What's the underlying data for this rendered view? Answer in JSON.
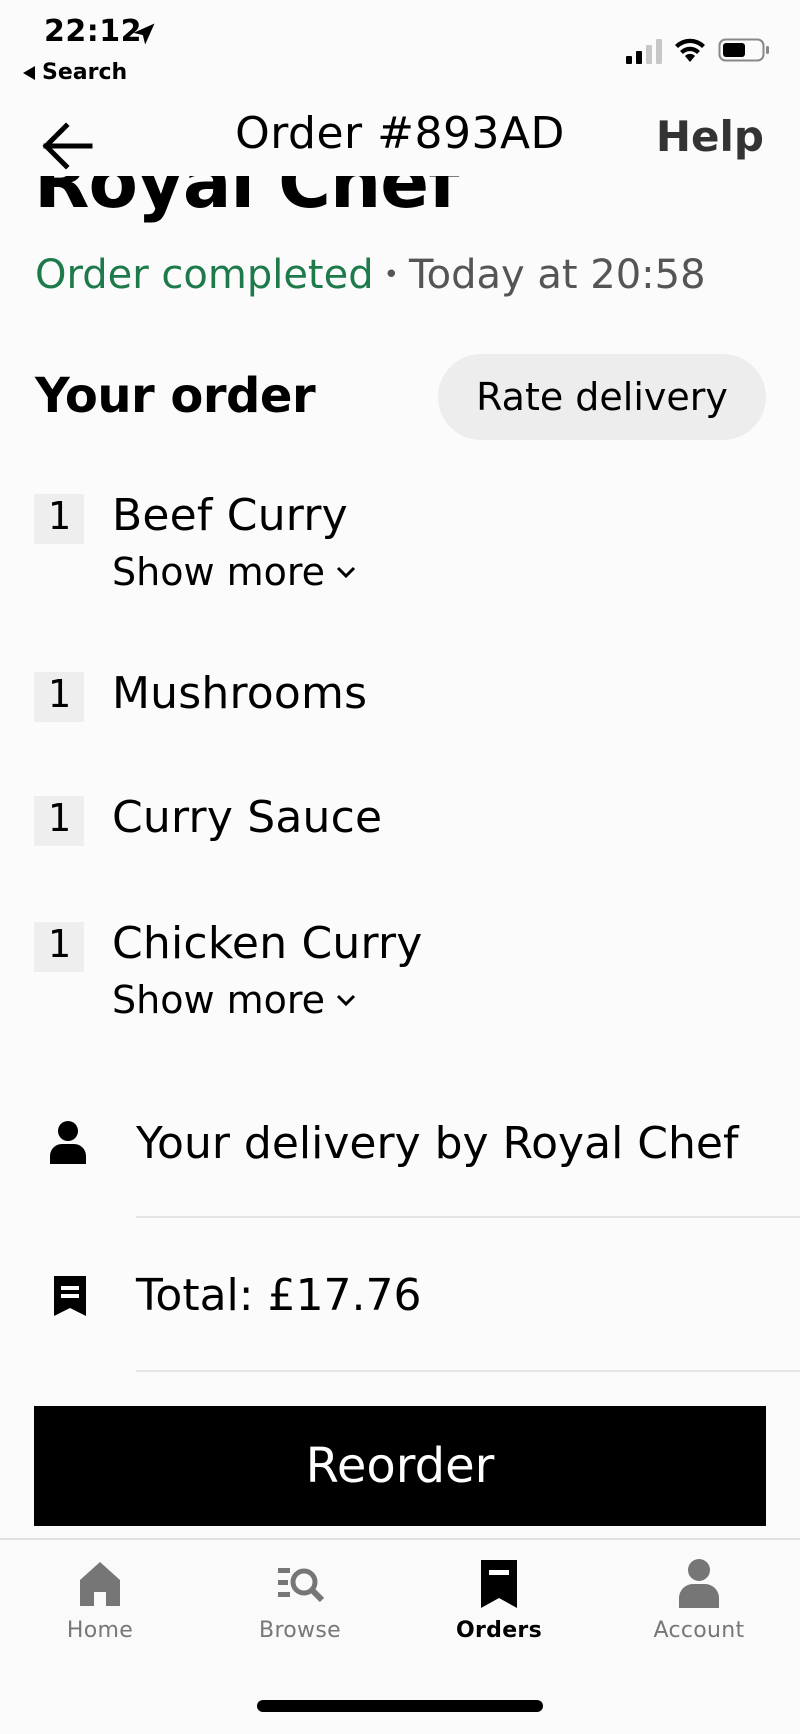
{
  "status_bar": {
    "time": "22:12",
    "back_app": "Search"
  },
  "nav": {
    "title": "Order #893AD",
    "help": "Help"
  },
  "restaurant": {
    "name": "Royal Chef",
    "status": "Order completed",
    "separator": "•",
    "time": "Today at 20:58"
  },
  "order": {
    "title": "Your order",
    "rate_button": "Rate delivery",
    "items": [
      {
        "qty": "1",
        "name": "Beef Curry",
        "show_more": "Show more"
      },
      {
        "qty": "1",
        "name": "Mushrooms"
      },
      {
        "qty": "1",
        "name": "Curry Sauce"
      },
      {
        "qty": "1",
        "name": "Chicken Curry",
        "show_more": "Show more"
      }
    ]
  },
  "details": {
    "delivery": "Your delivery by Royal Chef",
    "total": "Total: £17.76"
  },
  "reorder_button": "Reorder",
  "tabs": [
    {
      "label": "Home",
      "icon": "home-icon"
    },
    {
      "label": "Browse",
      "icon": "browse-icon"
    },
    {
      "label": "Orders",
      "icon": "orders-icon",
      "active": true
    },
    {
      "label": "Account",
      "icon": "account-icon"
    }
  ],
  "colors": {
    "status_green": "#1e7a4a",
    "button_black": "#000000",
    "pill_grey": "#ededee"
  }
}
